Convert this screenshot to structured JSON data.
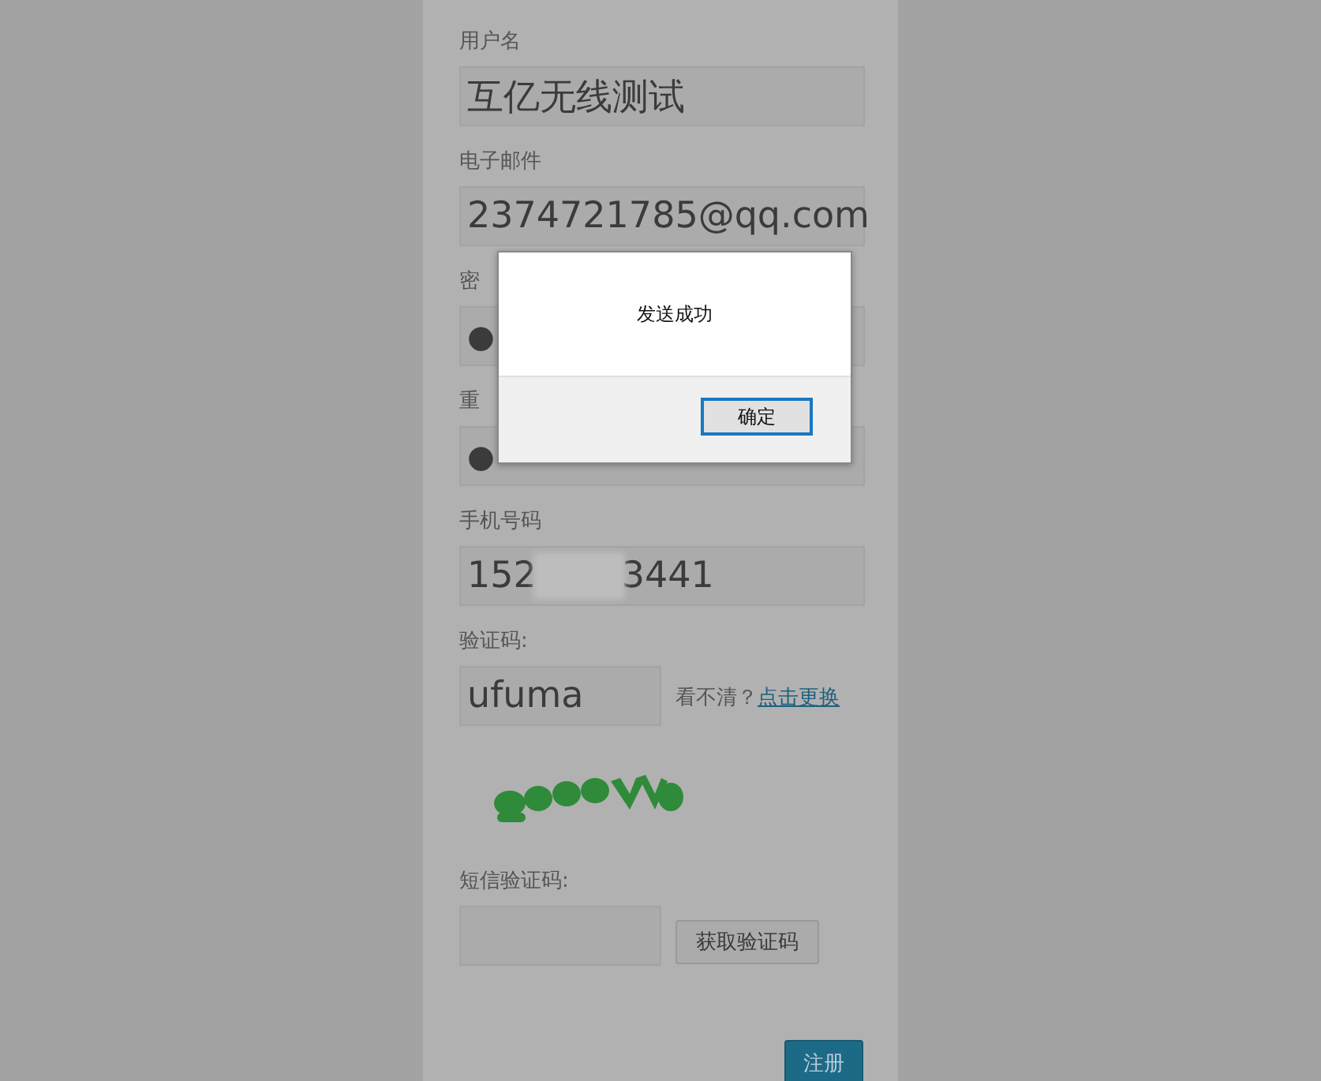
{
  "form": {
    "fields": [
      {
        "kind": "text",
        "label": "用户名",
        "value": "互亿无线测试"
      },
      {
        "kind": "text",
        "label": "电子邮件",
        "value": "2374721785@qq.com"
      },
      {
        "kind": "password",
        "label": "密",
        "value": "●"
      },
      {
        "kind": "password",
        "label": "重",
        "value": "●"
      },
      {
        "kind": "redacted",
        "label": "手机号码",
        "value_parts": [
          "152",
          "3441"
        ]
      },
      {
        "kind": "captcha",
        "label": "验证码:",
        "value": "ufuma",
        "hint": "看不清？",
        "link": "点击更换"
      },
      {
        "kind": "picture"
      },
      {
        "kind": "sms",
        "label": "短信验证码:",
        "button": "获取验证码"
      }
    ],
    "submit": "注册"
  },
  "dialog": {
    "message": "发送成功",
    "button": "确定"
  }
}
